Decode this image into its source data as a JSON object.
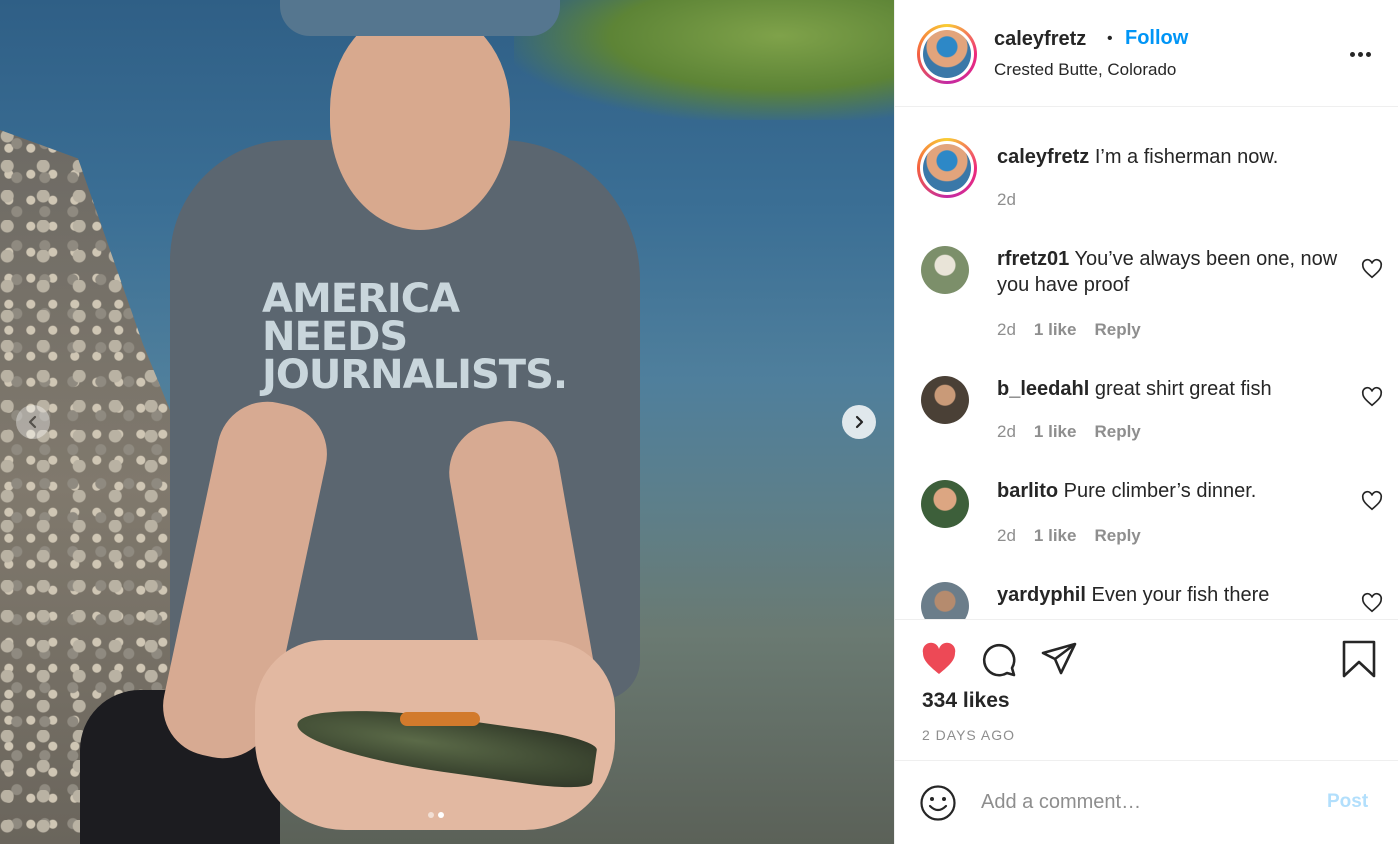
{
  "post": {
    "shirt_lines": [
      "AMERICA",
      "NEEDS",
      "JOURNALISTS."
    ]
  },
  "header": {
    "username": "caleyfretz",
    "separator": "•",
    "follow_label": "Follow",
    "location": "Crested Butte, Colorado"
  },
  "caption": {
    "username": "caleyfretz",
    "text": " I’m a fisherman now.",
    "time": "2d"
  },
  "comments": [
    {
      "username": "rfretz01",
      "text": " You’ve always been one, now you have proof",
      "time": "2d",
      "likes": "1 like",
      "reply": "Reply"
    },
    {
      "username": "b_leedahl",
      "text": " great shirt great fish",
      "time": "2d",
      "likes": "1 like",
      "reply": "Reply"
    },
    {
      "username": "barlito",
      "text": " Pure climber’s dinner.",
      "time": "2d",
      "likes": "1 like",
      "reply": "Reply"
    },
    {
      "username": "yardyphil",
      "text": " Even your fish there"
    }
  ],
  "actions": {
    "likes": "334 likes",
    "date": "2 DAYS AGO"
  },
  "composer": {
    "placeholder": "Add a comment…",
    "post_label": "Post"
  },
  "colors": {
    "link_blue": "#0095f6",
    "liked_red": "#ed4956",
    "muted": "#8e8e8e"
  },
  "icons": {
    "like": "heart-icon",
    "comment": "comment-bubble-icon",
    "share": "paper-plane-icon",
    "save": "bookmark-icon",
    "emoji": "smiley-icon",
    "more": "more-dots-icon",
    "prev": "chevron-left-icon",
    "next": "chevron-right-icon"
  },
  "carousel": {
    "slide_count": 2,
    "current_slide": 2
  }
}
